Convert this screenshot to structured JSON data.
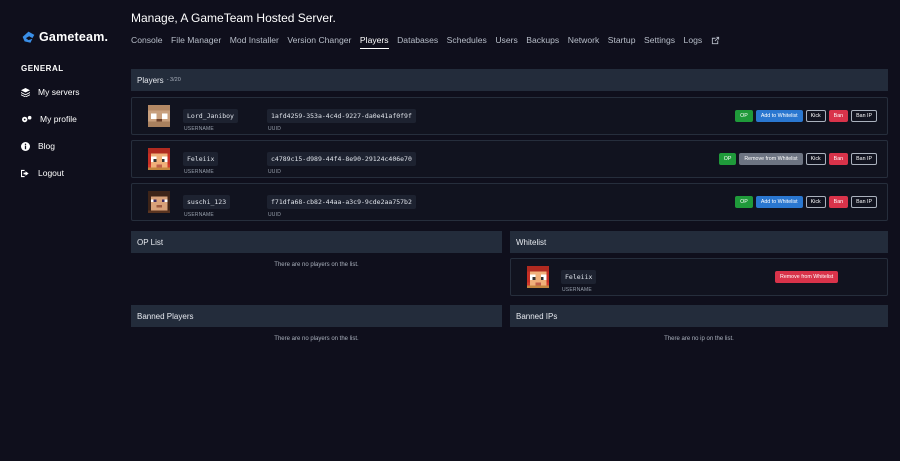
{
  "brand": {
    "name": "Gameteam."
  },
  "sidebar": {
    "heading": "GENERAL",
    "items": [
      {
        "label": "My servers",
        "icon": "layers-icon"
      },
      {
        "label": "My profile",
        "icon": "gears-icon"
      },
      {
        "label": "Blog",
        "icon": "info-icon"
      },
      {
        "label": "Logout",
        "icon": "logout-icon"
      }
    ]
  },
  "header": {
    "title": "Manage, A GameTeam Hosted Server.",
    "tabs": [
      "Console",
      "File Manager",
      "Mod Installer",
      "Version Changer",
      "Players",
      "Databases",
      "Schedules",
      "Users",
      "Backups",
      "Network",
      "Startup",
      "Settings",
      "Logs"
    ],
    "active_tab": "Players"
  },
  "players": {
    "title": "Players",
    "count": "- 3/20",
    "username_caption": "USERNAME",
    "uuid_caption": "UUID",
    "rows": [
      {
        "username": "Lord_Janiboy",
        "uuid": "1afd4259-353a-4c4d-9227-da0e41af0f9f",
        "whitelist_label": "Add to Whitelist",
        "whitelisted": false
      },
      {
        "username": "Feleiix",
        "uuid": "c4789c15-d989-44f4-8e90-29124c406e70",
        "whitelist_label": "Remove from Whitelist",
        "whitelisted": true
      },
      {
        "username": "suschi_123",
        "uuid": "f71dfa68-cb82-44aa-a3c9-9cde2aa757b2",
        "whitelist_label": "Add to Whitelist",
        "whitelisted": false
      }
    ],
    "buttons": {
      "op": "OP",
      "kick": "Kick",
      "ban": "Ban",
      "ban_ip": "Ban IP"
    }
  },
  "op_list": {
    "title": "OP List",
    "empty": "There are no players on the list."
  },
  "whitelist": {
    "title": "Whitelist",
    "entry": {
      "username": "Feleiix",
      "caption": "USERNAME",
      "button": "Remove from Whitelist"
    }
  },
  "banned_players": {
    "title": "Banned Players",
    "empty": "There are no players on the list."
  },
  "banned_ips": {
    "title": "Banned IPs",
    "empty": "There are no ip on the list."
  },
  "colors": {
    "background": "#0f0f1c",
    "panel_header": "#232c3b",
    "op_green": "#1f9a3a",
    "whitelist_blue": "#2a77d0",
    "ban_red": "#d9334a",
    "brand_blue": "#3a8fe8"
  }
}
